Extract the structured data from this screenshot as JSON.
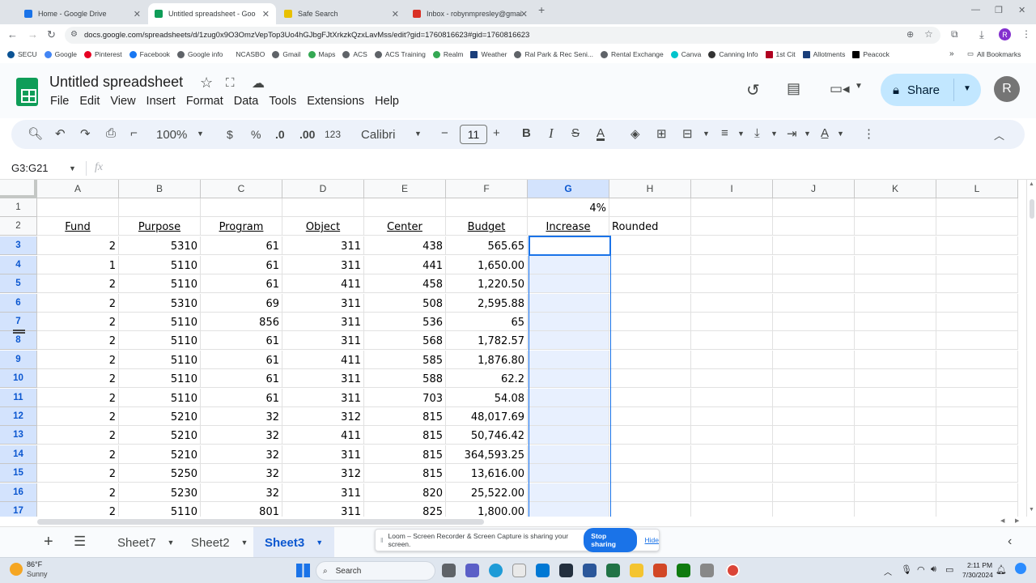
{
  "browser": {
    "tabs": [
      {
        "title": "Home - Google Drive",
        "color": "#1a73e8"
      },
      {
        "title": "Untitled spreadsheet - Google",
        "color": "#0f9d58"
      },
      {
        "title": "Safe Search",
        "color": "#e8c000"
      },
      {
        "title": "Inbox - robynmpresley@gmail",
        "color": "#d93025"
      }
    ],
    "url": "docs.google.com/spreadsheets/d/1zug0x9O3OmzVepTop3Uo4hGJbgFJtXrkzkQzxLavMss/edit?gid=1760816623#gid=1760816623",
    "bookmarks": [
      "SECU",
      "Google",
      "Pinterest",
      "Facebook",
      "Google info",
      "NCASBO",
      "Gmail",
      "Maps",
      "ACS",
      "ACS Training",
      "Realm",
      "Weather",
      "Ral Park & Rec Seni...",
      "Rental Exchange",
      "Canva",
      "Canning Info",
      "1st Cit",
      "Allotments",
      "Peacock"
    ],
    "all_bookmarks": "All Bookmarks",
    "profile_initial": "R"
  },
  "app": {
    "title": "Untitled spreadsheet",
    "menu": [
      "File",
      "Edit",
      "View",
      "Insert",
      "Format",
      "Data",
      "Tools",
      "Extensions",
      "Help"
    ],
    "share_label": "Share",
    "avatar": "R"
  },
  "toolbar": {
    "zoom": "100%",
    "currency": "$",
    "percent": "%",
    "dec_decrease": ".0",
    "dec_increase": ".00",
    "number_format": "123",
    "font": "Calibri",
    "font_size": "11"
  },
  "formula_bar": {
    "name_box": "G3:G21",
    "fx": "fx",
    "value": ""
  },
  "grid": {
    "columns": [
      "A",
      "B",
      "C",
      "D",
      "E",
      "F",
      "G",
      "H",
      "I",
      "J",
      "K",
      "L"
    ],
    "selected_column": "G",
    "row_numbers": [
      "1",
      "2",
      "3",
      "4",
      "5",
      "6",
      "7",
      "8",
      "9",
      "10",
      "11",
      "12",
      "13",
      "14",
      "15",
      "16",
      "17"
    ],
    "g1": "4%",
    "headers": [
      "Fund",
      "Purpose",
      "Program",
      "Object",
      "Center",
      "Budget",
      "Increase"
    ],
    "h2": "Rounded",
    "rows": [
      [
        "2",
        "5310",
        "61",
        "311",
        "438",
        "565.65"
      ],
      [
        "1",
        "5110",
        "61",
        "311",
        "441",
        "1,650.00"
      ],
      [
        "2",
        "5110",
        "61",
        "411",
        "458",
        "1,220.50"
      ],
      [
        "2",
        "5310",
        "69",
        "311",
        "508",
        "2,595.88"
      ],
      [
        "2",
        "5110",
        "856",
        "311",
        "536",
        "65"
      ],
      [
        "2",
        "5110",
        "61",
        "311",
        "568",
        "1,782.57"
      ],
      [
        "2",
        "5110",
        "61",
        "411",
        "585",
        "1,876.80"
      ],
      [
        "2",
        "5110",
        "61",
        "311",
        "588",
        "62.2"
      ],
      [
        "2",
        "5110",
        "61",
        "311",
        "703",
        "54.08"
      ],
      [
        "2",
        "5210",
        "32",
        "312",
        "815",
        "48,017.69"
      ],
      [
        "2",
        "5210",
        "32",
        "411",
        "815",
        "50,746.42"
      ],
      [
        "2",
        "5210",
        "32",
        "311",
        "815",
        "364,593.25"
      ],
      [
        "2",
        "5250",
        "32",
        "312",
        "815",
        "13,616.00"
      ],
      [
        "2",
        "5230",
        "32",
        "311",
        "820",
        "25,522.00"
      ],
      [
        "2",
        "5110",
        "801",
        "311",
        "825",
        "1,800.00"
      ]
    ]
  },
  "sheets": {
    "tabs": [
      "Sheet7",
      "Sheet2",
      "Sheet3"
    ],
    "active": "Sheet3"
  },
  "loom": {
    "message": "Loom – Screen Recorder & Screen Capture is sharing your screen.",
    "stop": "Stop sharing",
    "hide": "Hide"
  },
  "taskbar": {
    "temp": "86°F",
    "weather": "Sunny",
    "search": "Search",
    "time": "2:11 PM",
    "date": "7/30/2024"
  }
}
